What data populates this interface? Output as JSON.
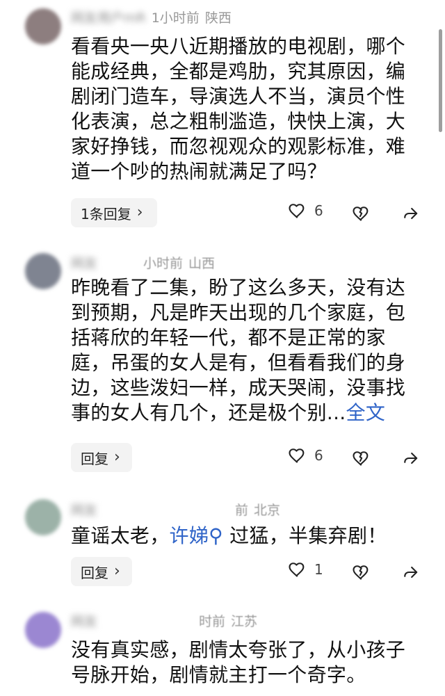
{
  "comments": [
    {
      "author_blurred": "网友用户mR",
      "time": "1小时前",
      "location": "陕西",
      "text": "看看央一央八近期播放的电视剧，哪个能成经典，全都是鸡肋，究其原因，编剧闭门造车，导演选人不当，演员个性化表演，总之粗制滥造，快快上演，大家好挣钱，而忽视观众的观影标准，难道一个吵的热闹就满足了吗？",
      "reply_label": "1条回复",
      "like_count": "6",
      "avatar_color": "#8d7e7f"
    },
    {
      "author_blurred": "网友",
      "time": "小时前",
      "location": "山西",
      "text_main": "昨晚看了二集，盼了这么多天，没有达到预期，凡是昨天出现的几个家庭，包括蒋欣的年轻一代，都不是正常的家庭，吊蛋的女人是有，但看看我们的身边，这些泼妇一样，成天哭闹，没事找事的女人有几个，还是极个别...",
      "more_label": "全文",
      "reply_label": "回复",
      "like_count": "6",
      "avatar_color": "#7f8491"
    },
    {
      "author_blurred": "网友",
      "time": "前",
      "location": "北京",
      "text_before": "童谣太老，",
      "mention": "许娣",
      "text_after": " 过猛，半集弃剧！",
      "reply_label": "回复",
      "like_count": "1",
      "avatar_color": "#9cb2a8"
    },
    {
      "author_blurred": "网友",
      "time": "时前",
      "location": "江苏",
      "text": "没有真实感，剧情太夸张了，从小孩子号脉开始，剧情就主打一个奇字。",
      "avatar_color": "#9b87d2"
    }
  ]
}
